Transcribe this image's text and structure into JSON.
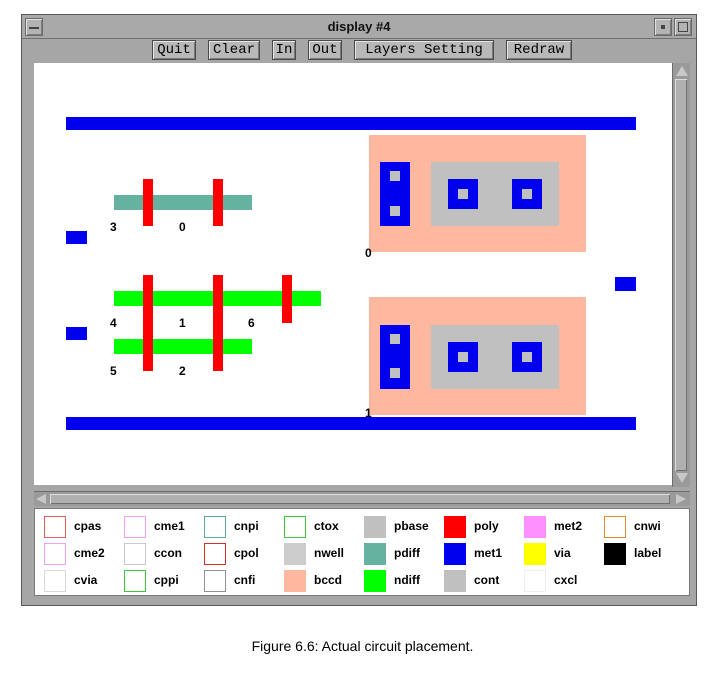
{
  "window": {
    "title": "display #4"
  },
  "toolbar": {
    "buttons": [
      {
        "label": "Quit"
      },
      {
        "label": "Clear"
      },
      {
        "label": "In"
      },
      {
        "label": "Out"
      },
      {
        "label": "Layers Setting"
      },
      {
        "label": "Redraw"
      }
    ]
  },
  "canvas": {
    "labels": [
      "3",
      "0",
      "0",
      "4",
      "1",
      "6",
      "5",
      "2",
      "1"
    ]
  },
  "legend": {
    "items": [
      {
        "label": "cpas",
        "style": "outline",
        "color": "#e06060"
      },
      {
        "label": "cme1",
        "style": "outline",
        "color": "#f0a0f0"
      },
      {
        "label": "cnpi",
        "style": "outline",
        "color": "#5fa896"
      },
      {
        "label": "ctox",
        "style": "outline",
        "color": "#3ac83a"
      },
      {
        "label": "pbase",
        "style": "fill",
        "color": "#c0c0c0"
      },
      {
        "label": "poly",
        "style": "fill",
        "color": "#ff0000"
      },
      {
        "label": "met2",
        "style": "fill",
        "color": "#ff90ff"
      },
      {
        "label": "cnwi",
        "style": "outline",
        "color": "#e08a30"
      },
      {
        "label": "cme2",
        "style": "outline",
        "color": "#f0a0f0"
      },
      {
        "label": "ccon",
        "style": "outline",
        "color": "#c8c8c8"
      },
      {
        "label": "cpol",
        "style": "outline",
        "color": "#d03030"
      },
      {
        "label": "nwell",
        "style": "fill",
        "color": "#cccccc"
      },
      {
        "label": "pdiff",
        "style": "fill",
        "color": "#66b2a0"
      },
      {
        "label": "met1",
        "style": "fill",
        "color": "#0000ee"
      },
      {
        "label": "via",
        "style": "fill",
        "color": "#ffff00"
      },
      {
        "label": "label",
        "style": "fill",
        "color": "#000000"
      },
      {
        "label": "cvia",
        "style": "outline",
        "color": "#d8d8d8"
      },
      {
        "label": "cppi",
        "style": "outline",
        "color": "#3ac83a"
      },
      {
        "label": "cnfi",
        "style": "outline",
        "color": "#909090"
      },
      {
        "label": "bccd",
        "style": "fill",
        "color": "#ffb8a0"
      },
      {
        "label": "ndiff",
        "style": "fill",
        "color": "#00ff00"
      },
      {
        "label": "cont",
        "style": "fill",
        "color": "#c0c0c0"
      },
      {
        "label": "cxcl",
        "style": "outline",
        "color": "#eeeeee"
      }
    ]
  },
  "caption": "Figure 6.6:  Actual circuit placement."
}
